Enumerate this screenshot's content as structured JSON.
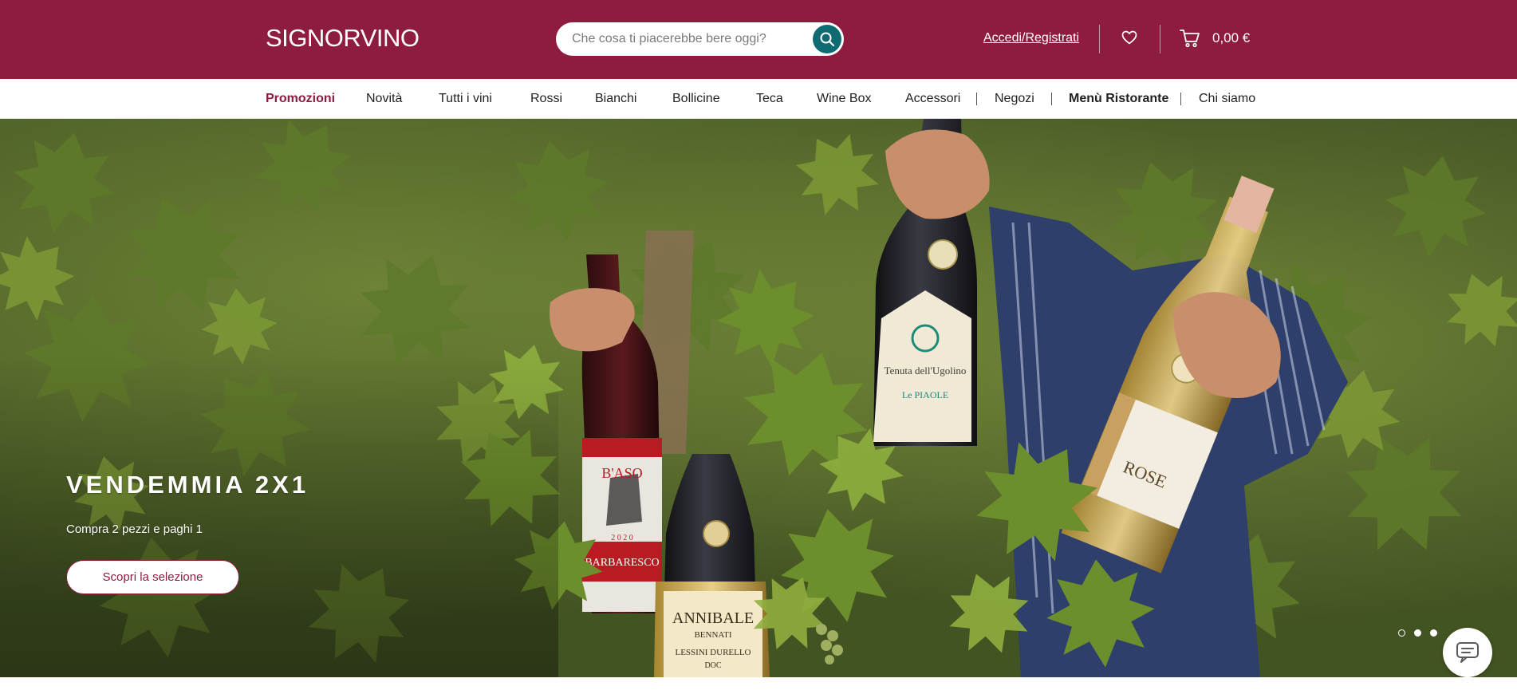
{
  "header": {
    "logo": "SIGNORVINO",
    "search_placeholder": "Che cosa ti piacerebbe bere oggi?",
    "login_label": "Accedi/Registrati",
    "cart_total": "0,00 €",
    "brand_color": "#8e1c3f",
    "search_button_color": "#0e6b72"
  },
  "nav": {
    "items": [
      {
        "label": "Promozioni"
      },
      {
        "label": "Novità"
      },
      {
        "label": "Tutti i vini"
      },
      {
        "label": "Rossi"
      },
      {
        "label": "Bianchi"
      },
      {
        "label": "Bollicine"
      },
      {
        "label": "Teca"
      },
      {
        "label": "Wine Box"
      },
      {
        "label": "Accessori"
      },
      {
        "label": "Negozi"
      },
      {
        "label": "Menù Ristorante"
      },
      {
        "label": "Chi siamo"
      }
    ]
  },
  "hero": {
    "title": "VENDEMMIA 2X1",
    "subtitle": "Compra 2 pezzi e paghi 1",
    "cta_label": "Scopri la selezione",
    "slide_count": 3,
    "active_slide": 2,
    "bottle_labels": {
      "baso_brand": "B'ASO",
      "baso_wine": "BARBARESCO",
      "baso_year": "2 0 2 0",
      "annibale_name": "ANNIBALE",
      "annibale_maker": "BENNATI",
      "annibale_wine": "LESSINI DURELLO",
      "annibale_doc": "DOC",
      "ugolino_name": "Tenuta dell'Ugolino",
      "ugolino_wine": "Le PIAOLE",
      "rose_name": "ROSE"
    }
  },
  "icons": {
    "search": "search-icon",
    "wishlist": "heart-icon",
    "cart": "cart-icon",
    "chat": "chat-icon"
  }
}
